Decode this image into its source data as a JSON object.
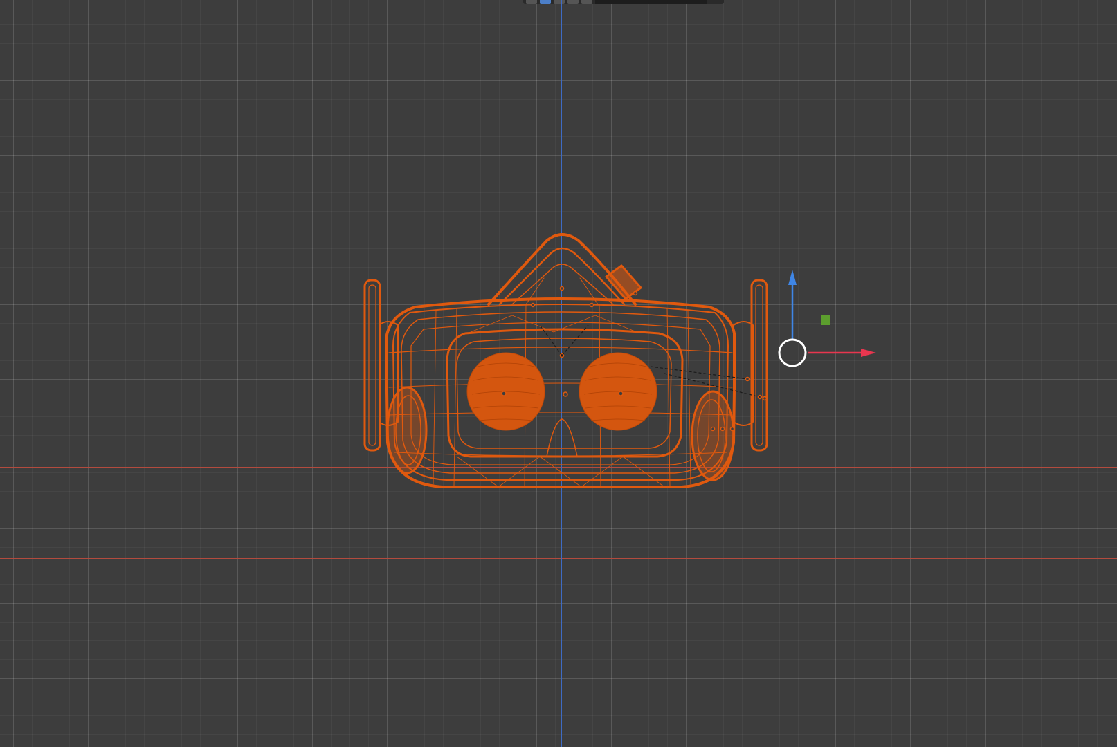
{
  "viewport": {
    "view": "front",
    "shading": "wireframe",
    "background_color": "#3d3d3d",
    "grid": true
  },
  "object": {
    "type": "vr-headset",
    "selected": true,
    "wire_color": "#e0590e"
  },
  "axes": {
    "x_color": "#e8364f",
    "z_color": "#3f86e6",
    "y_handle_color": "#5c9e2e",
    "guide_color": "#b34b3e"
  },
  "header": {
    "visible_buttons": 5,
    "active_color": "#4c7fc8"
  }
}
